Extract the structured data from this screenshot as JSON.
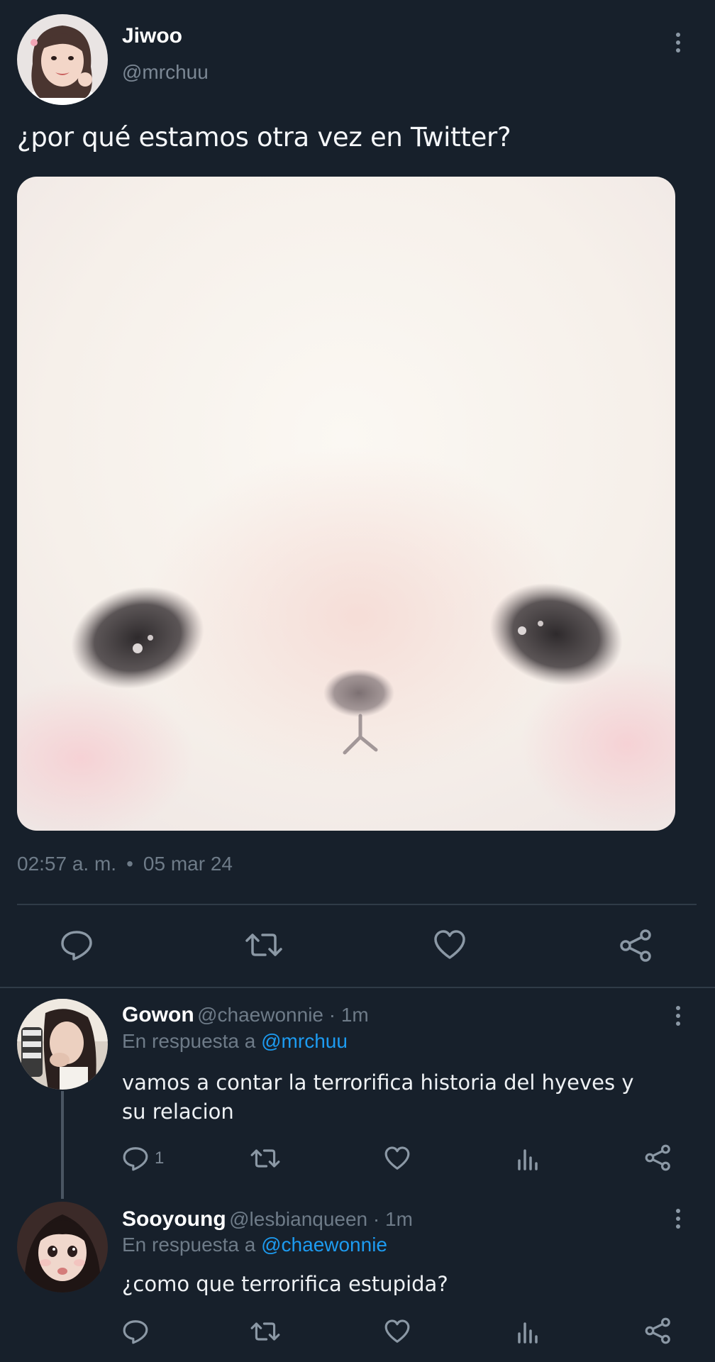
{
  "main_tweet": {
    "author_name": "Jiwoo",
    "author_handle": "@mrchuu",
    "text": "¿por qué estamos otra vez en Twitter?",
    "time": "02:57 a. m.",
    "separator": "•",
    "date": "05 mar 24",
    "actions": [
      "reply-icon",
      "retweet-icon",
      "like-icon",
      "share-icon"
    ]
  },
  "replies": [
    {
      "author_name": "Gowon",
      "author_handle": "@chaewonnie · 1m",
      "reply_prefix": "En respuesta a",
      "reply_to": "@mrchuu",
      "text": "vamos a contar la terrorifica historia del hyeves y su relacion",
      "reply_count": "1"
    },
    {
      "author_name": "Sooyoung",
      "author_handle": "@lesbianqueen · 1m",
      "reply_prefix": "En respuesta a",
      "reply_to": "@chaewonnie",
      "text": "¿como que terrorifica estupida?",
      "reply_count": ""
    }
  ],
  "colors": {
    "background": "#17202b",
    "accent": "#1d9bf0",
    "muted_text": "#6e7b88",
    "icon": "#8b98a5",
    "divider": "#2f3b47"
  }
}
